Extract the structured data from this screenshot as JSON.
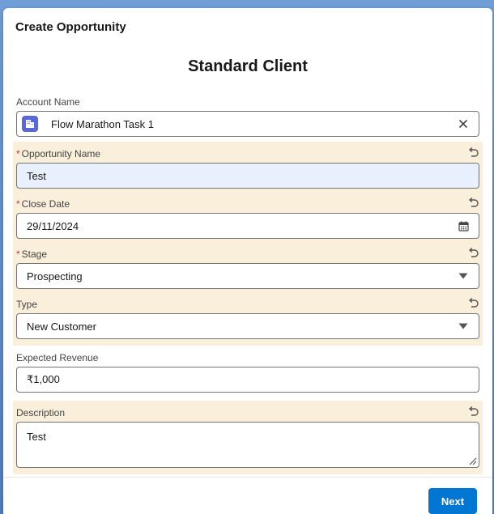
{
  "modal": {
    "title": "Create Opportunity",
    "form_title": "Standard Client"
  },
  "fields": {
    "account_name": {
      "label": "Account Name",
      "value": "Flow Marathon Task 1"
    },
    "opportunity_name": {
      "label": "Opportunity Name",
      "required": "*",
      "value": "Test"
    },
    "close_date": {
      "label": "Close Date",
      "required": "*",
      "value": "29/11/2024"
    },
    "stage": {
      "label": "Stage",
      "required": "*",
      "value": "Prospecting"
    },
    "type": {
      "label": "Type",
      "value": "New Customer"
    },
    "expected_revenue": {
      "label": "Expected Revenue",
      "value": "₹1,000"
    },
    "description": {
      "label": "Description",
      "value": "Test"
    }
  },
  "footer": {
    "next_label": "Next"
  },
  "colors": {
    "brand": "#0176d3",
    "changed_bg": "#faefdb",
    "focused_bg": "#e8f0fd",
    "required": "#c23934",
    "account_icon": "#5a67d8"
  },
  "icons": {
    "account": "account-icon",
    "clear": "close-icon",
    "undo": "undo-icon",
    "calendar": "calendar-icon",
    "dropdown": "chevron-down-icon",
    "resize": "resize-handle-icon"
  }
}
